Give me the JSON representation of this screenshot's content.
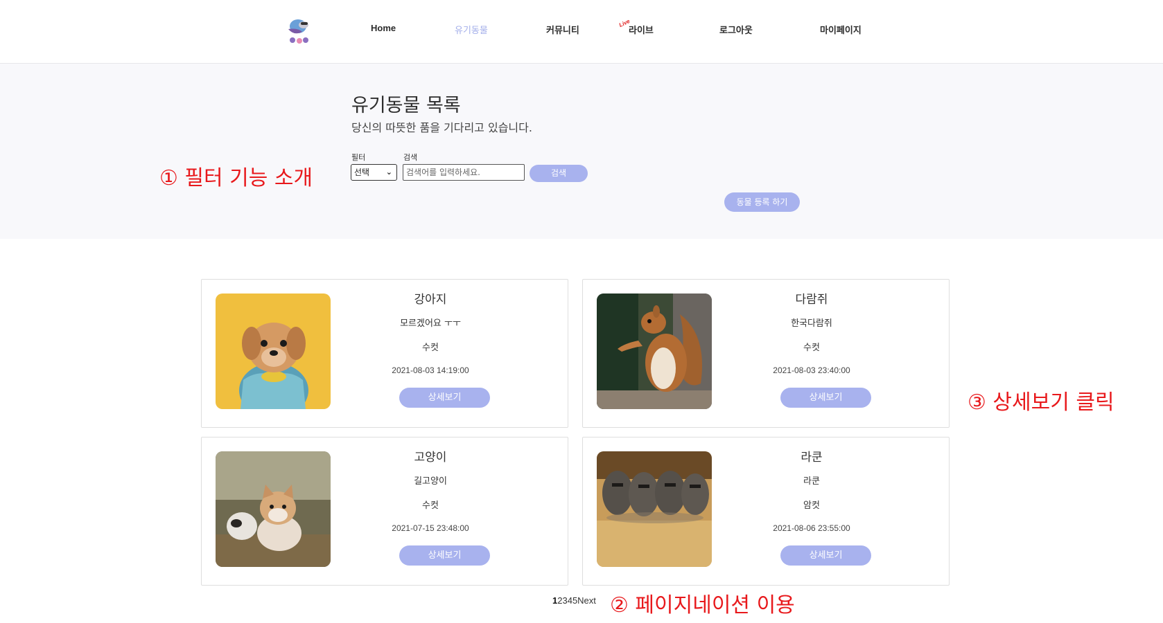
{
  "nav": {
    "items": [
      {
        "label": "Home",
        "active": false
      },
      {
        "label": "유기동물",
        "active": true
      },
      {
        "label": "커뮤니티",
        "active": false
      },
      {
        "label": "라이브",
        "active": false,
        "badge": "Live"
      },
      {
        "label": "로그아웃",
        "active": false
      },
      {
        "label": "마이페이지",
        "active": false
      }
    ]
  },
  "hero": {
    "title": "유기동물 목록",
    "subtitle": "당신의 따뜻한 품을 기다리고 있습니다.",
    "filter_label": "필터",
    "filter_value": "선택",
    "search_label": "검색",
    "search_placeholder": "검색어를 입력하세요.",
    "search_button": "검색",
    "register_button": "동물 등록 하기"
  },
  "annotations": {
    "filter": "① 필터 기능 소개",
    "pagination": "② 페이지네이션 이용",
    "detail": "③ 상세보기 클릭"
  },
  "cards": [
    {
      "name": "강아지",
      "breed": "모르겠어요 ㅜㅜ",
      "gender": "수컷",
      "date": "2021-08-03 14:19:00",
      "button": "상세보기",
      "image": "puppy-photo"
    },
    {
      "name": "다람쥐",
      "breed": "한국다람쥐",
      "gender": "수컷",
      "date": "2021-08-03 23:40:00",
      "button": "상세보기",
      "image": "squirrel-photo"
    },
    {
      "name": "고양이",
      "breed": "길고양이",
      "gender": "수컷",
      "date": "2021-07-15 23:48:00",
      "button": "상세보기",
      "image": "kitten-photo"
    },
    {
      "name": "라쿤",
      "breed": "라쿤",
      "gender": "암컷",
      "date": "2021-08-06 23:55:00",
      "button": "상세보기",
      "image": "raccoon-photo"
    }
  ],
  "pagination": {
    "pages": [
      "1",
      "2",
      "3",
      "4",
      "5"
    ],
    "current": "1",
    "next": "Next"
  },
  "colors": {
    "accent": "#a8b2ee",
    "annotation": "#e8191c",
    "hero_bg": "#f8f8fb"
  }
}
